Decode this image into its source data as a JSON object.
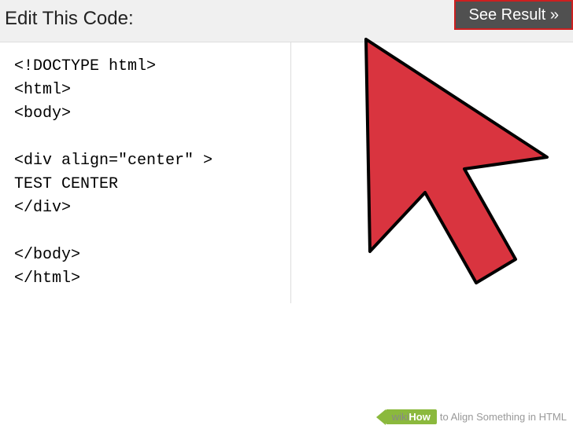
{
  "header": {
    "title": "Edit This Code:",
    "see_result_label": "See Result »"
  },
  "code": {
    "content": "<!DOCTYPE html>\n<html>\n<body>\n\n<div align=\"center\" >\nTEST CENTER\n</div>\n\n</body>\n</html>"
  },
  "watermark": {
    "wiki": "wiki",
    "how": "How",
    "title": "to Align Something in HTML"
  }
}
